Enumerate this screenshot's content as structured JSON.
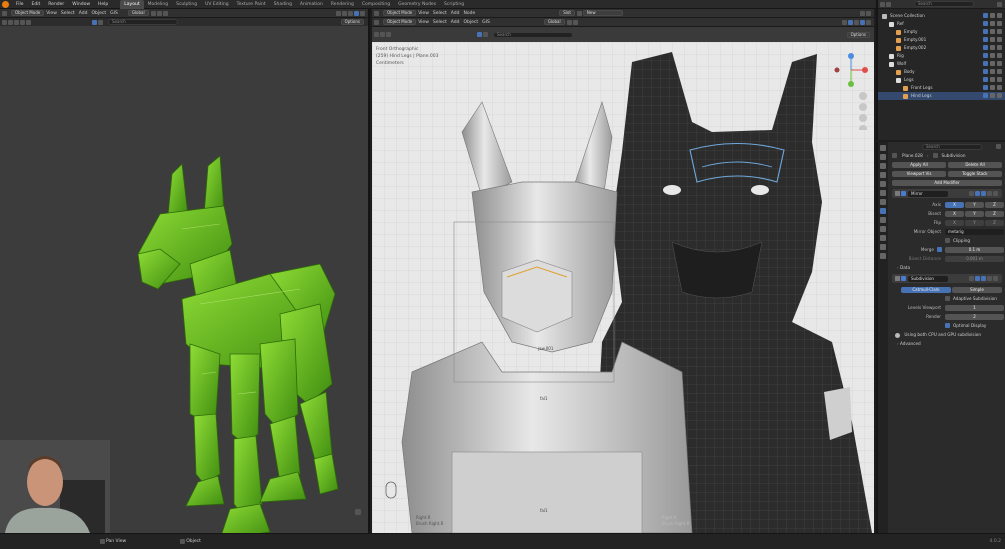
{
  "menubar": {
    "items": [
      "File",
      "Edit",
      "Render",
      "Window",
      "Help"
    ],
    "workspaces": [
      "Layout",
      "Modeling",
      "Sculpting",
      "UV Editing",
      "Texture Paint",
      "Shading",
      "Animation",
      "Rendering",
      "Compositing",
      "Geometry Nodes",
      "Scripting"
    ],
    "active_workspace": "Layout",
    "scene_label": "Scene",
    "view_layer_label": "ViewLayer"
  },
  "left_viewport": {
    "mode": "Object Mode",
    "menus": [
      "View",
      "Select",
      "Add",
      "Object",
      "GIS"
    ],
    "transform": "Global",
    "search_placeholder": "Search",
    "options_label": "Options"
  },
  "middle_viewport": {
    "editor_menus": [
      "Object Mode",
      "View",
      "Select",
      "Add",
      "Node"
    ],
    "slot_label": "Slot",
    "new_label": "New",
    "mode": "Object Mode",
    "menus": [
      "View",
      "Select",
      "Add",
      "Object",
      "GIS"
    ],
    "transform": "Global",
    "search_placeholder": "Search",
    "options_label": "Options",
    "overlay_line1": "Front Orthographic",
    "overlay_line2": "(259) Hind Legs | Plane.003",
    "overlay_line3": "Centimeters",
    "label_jaw": "jaw.001",
    "label_1": "fal1",
    "label_2": "fal1",
    "bottom_left_label": "Right.R",
    "bottom_left_label2": "Brush Right.R",
    "bottom_right_label": "Right.R",
    "bottom_right_label2": "Brush Right.R"
  },
  "outliner": {
    "search_placeholder": "Search",
    "items": [
      {
        "label": "Scene Collection",
        "indent": 0,
        "icon_color": "#bbbbbb"
      },
      {
        "label": "Ref",
        "indent": 1,
        "icon_color": "#dddddd"
      },
      {
        "label": "Empty",
        "indent": 2,
        "icon_color": "#e0a050"
      },
      {
        "label": "Empty.001",
        "indent": 2,
        "icon_color": "#e0a050"
      },
      {
        "label": "Empty.002",
        "indent": 2,
        "icon_color": "#e0a050"
      },
      {
        "label": "Rig",
        "indent": 1,
        "icon_color": "#dddddd"
      },
      {
        "label": "Wolf",
        "indent": 1,
        "icon_color": "#dddddd"
      },
      {
        "label": "Body",
        "indent": 2,
        "icon_color": "#e0a050"
      },
      {
        "label": "Legs",
        "indent": 2,
        "icon_color": "#dddddd"
      },
      {
        "label": "Front Legs",
        "indent": 3,
        "icon_color": "#e0a050"
      },
      {
        "label": "Hind Legs",
        "indent": 3,
        "icon_color": "#e0a050"
      }
    ]
  },
  "properties": {
    "search_placeholder": "Search",
    "breadcrumb_object": "Plane.028",
    "breadcrumb_modifier": "Subdivision",
    "apply_all": "Apply All",
    "delete_all": "Delete All",
    "viewport_vis": "Viewport Vis",
    "toggle_stack": "Toggle Stack",
    "add_modifier": "Add Modifier",
    "mirror": {
      "name": "Mirror",
      "axis_label": "Axis",
      "bisect_label": "Bisect",
      "flip_label": "Flip",
      "axes": [
        "X",
        "Y",
        "Z"
      ],
      "mirror_object_label": "Mirror Object",
      "mirror_object_value": "metarig",
      "clipping_label": "Clipping",
      "merge_label": "Merge",
      "merge_value": "0.1 m",
      "bisect_distance_label": "Bisect Distance",
      "bisect_distance_value": "0.001 m",
      "data_label": "Data"
    },
    "subdivision": {
      "name": "Subdivision",
      "catmull": "Catmull-Clark",
      "simple": "Simple",
      "adaptive": "Adaptive Subdivision",
      "levels_viewport_label": "Levels Viewport",
      "levels_viewport_value": "1",
      "render_label": "Render",
      "render_value": "2",
      "optimal_display": "Optimal Display",
      "info": "Using both CPU and GPU subdivision",
      "advanced": "Advanced"
    }
  },
  "statusbar": {
    "left_hint": "Pan View",
    "middle_hint": "Object",
    "version": "4.0.2"
  }
}
